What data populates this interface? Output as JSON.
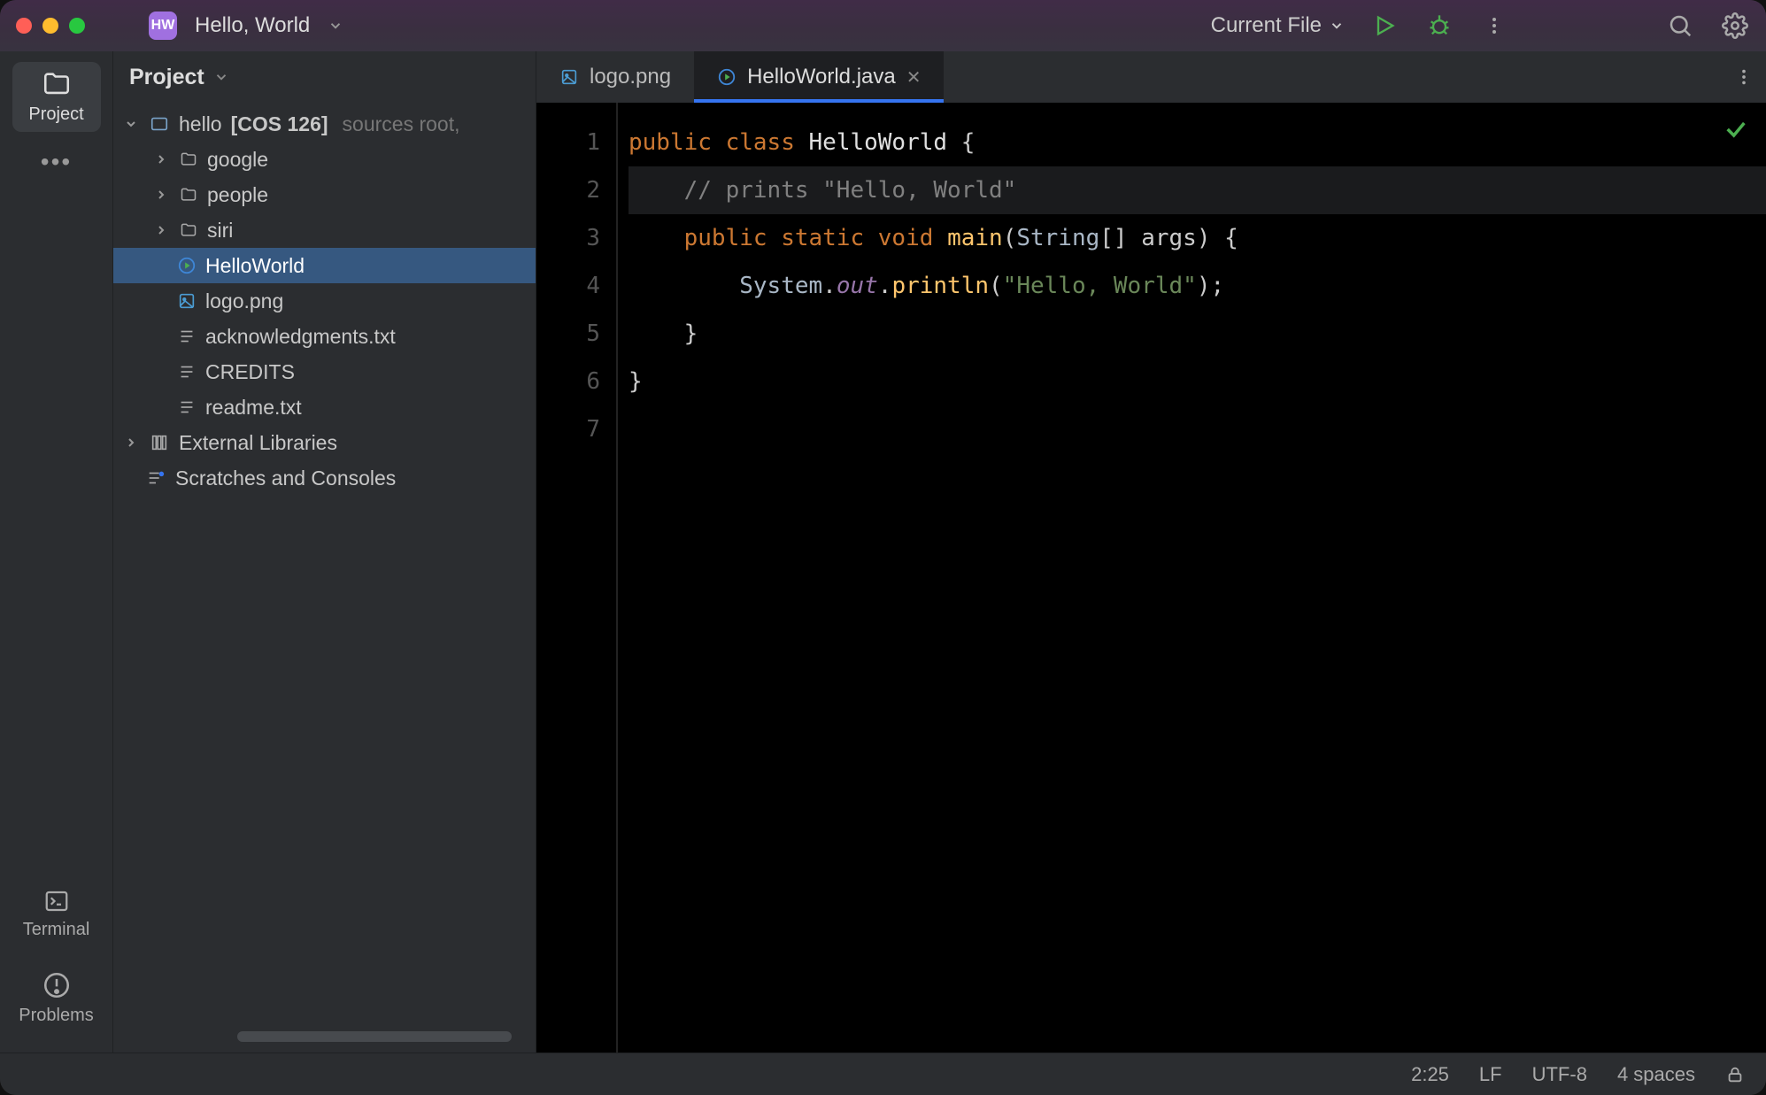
{
  "titlebar": {
    "badge": "HW",
    "title": "Hello, World",
    "run_config": "Current File"
  },
  "rail": {
    "project": "Project",
    "terminal": "Terminal",
    "problems": "Problems"
  },
  "tree": {
    "header": "Project",
    "root": {
      "name": "hello",
      "qualifier": "[COS 126]",
      "note": "sources root,"
    },
    "folders": [
      "google",
      "people",
      "siri"
    ],
    "files": {
      "helloworld": "HelloWorld",
      "logo": "logo.png",
      "ack": "acknowledgments.txt",
      "credits": "CREDITS",
      "readme": "readme.txt"
    },
    "external": "External Libraries",
    "scratches": "Scratches and Consoles"
  },
  "tabs": [
    {
      "label": "logo.png"
    },
    {
      "label": "HelloWorld.java"
    }
  ],
  "code": {
    "l1a": "public",
    "l1b": "class",
    "l1c": "HelloWorld",
    "l2": "// prints \"Hello, World\"",
    "l3a": "public",
    "l3b": "static",
    "l3c": "void",
    "l3d": "main",
    "l3e": "String",
    "l4a": "System",
    "l4b": "out",
    "l4c": "println",
    "l4d": "\"Hello, World\""
  },
  "gutter": [
    "1",
    "2",
    "3",
    "4",
    "5",
    "6",
    "7"
  ],
  "status": {
    "pos": "2:25",
    "eol": "LF",
    "enc": "UTF-8",
    "indent": "4 spaces"
  }
}
